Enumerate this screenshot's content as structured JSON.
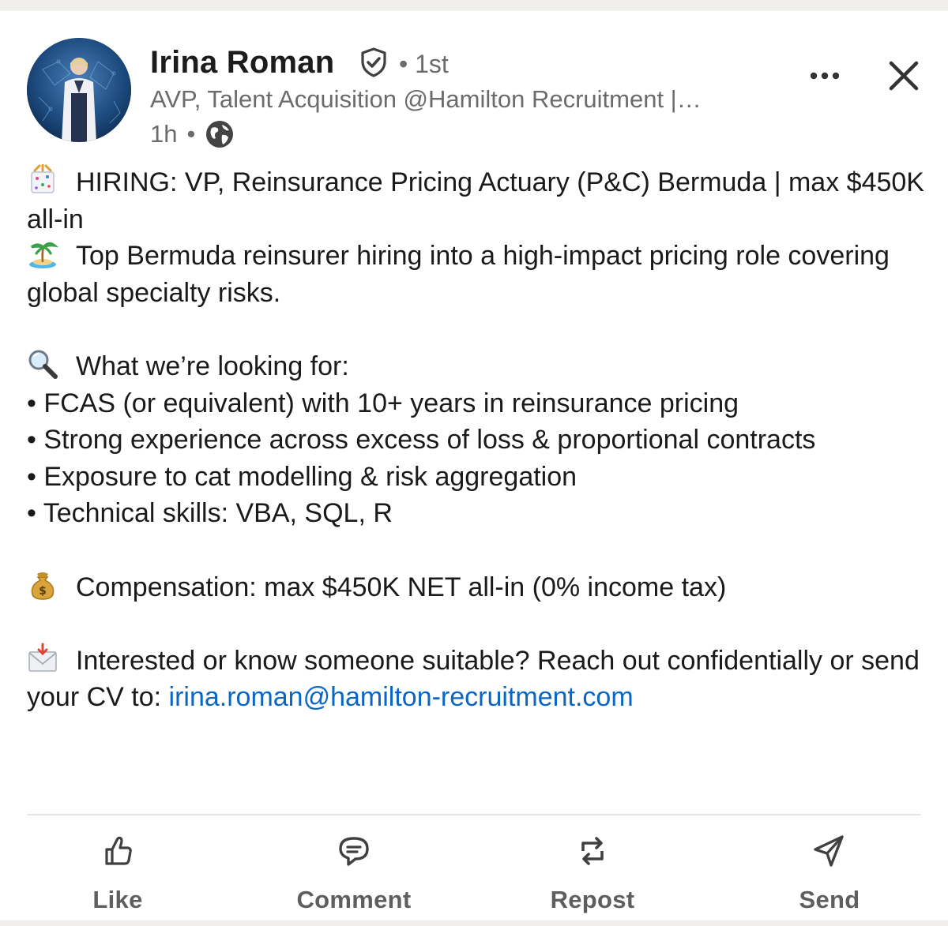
{
  "author": {
    "name": "Irina Roman",
    "degree": "• 1st",
    "headline": "AVP, Talent Acquisition @Hamilton Recruitment |…",
    "time": "1h",
    "separator": "•"
  },
  "icons": {
    "verified": "verified-shield-icon",
    "visibility": "globe-icon",
    "more": "more-options-icon",
    "close": "close-icon"
  },
  "post": {
    "line1": "HIRING: VP, Reinsurance Pricing Actuary (P&C) Bermuda | max $450K all-in",
    "line2": "Top Bermuda reinsurer hiring into a high-impact pricing role covering global specialty risks.",
    "looking_heading": "What we’re looking for:",
    "bullets": [
      "• FCAS (or equivalent) with 10+ years in reinsurance pricing",
      "• Strong experience across excess of loss & proportional contracts",
      "• Exposure to cat modelling & risk aggregation",
      "• Technical skills: VBA, SQL, R"
    ],
    "compensation": "Compensation: max $450K NET all-in (0% income tax)",
    "contact_text": "Interested or know someone suitable? Reach out confidentially or send your CV to: ",
    "contact_email": "irina.roman@hamilton-recruitment.com"
  },
  "actions": {
    "like": "Like",
    "comment": "Comment",
    "repost": "Repost",
    "send": "Send"
  },
  "colors": {
    "link": "#0a66c2",
    "text": "#1a1a1a",
    "muted": "#6b6b6b"
  }
}
